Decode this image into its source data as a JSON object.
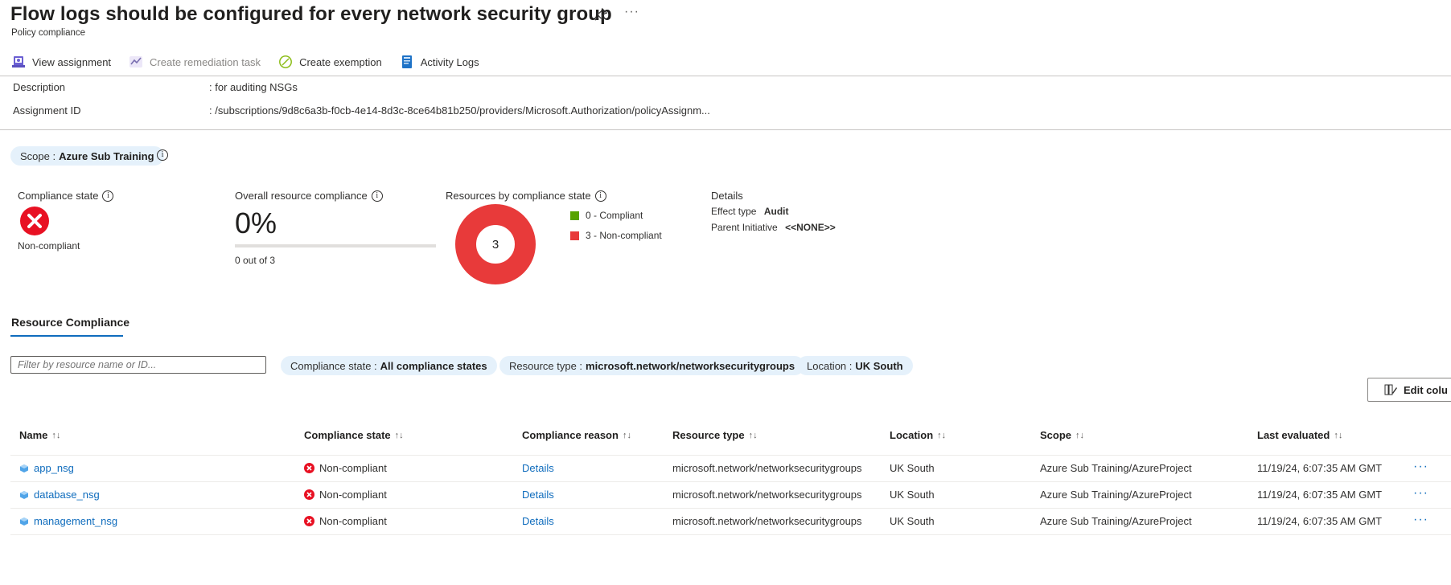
{
  "header": {
    "title": "Flow logs should be configured for every network security group",
    "subtitle": "Policy compliance"
  },
  "toolbar": {
    "view_assignment": "View assignment",
    "create_remediation": "Create remediation task",
    "create_exemption": "Create exemption",
    "activity_logs": "Activity Logs"
  },
  "info": {
    "description_label": "Description",
    "description_value": ": for auditing NSGs",
    "assignment_label": "Assignment ID",
    "assignment_value": ": /subscriptions/9d8c6a3b-f0cb-4e14-8d3c-8ce64b81b250/providers/Microsoft.Authorization/policyAssignm..."
  },
  "scope": {
    "label": "Scope :",
    "value": "Azure Sub Training"
  },
  "summary": {
    "compliance_state_label": "Compliance state",
    "compliance_state_value": "Non-compliant",
    "overall_label": "Overall resource compliance",
    "overall_percent": "0%",
    "overall_fraction": 0,
    "overall_sub": "0 out of 3",
    "resources_label": "Resources by compliance state",
    "donut_total": "3",
    "legend_compliant": "0 - Compliant",
    "legend_noncompliant": "3 - Non-compliant",
    "compliant_color": "#57a300",
    "noncompliant_color": "#e83a3a",
    "details_label": "Details",
    "effect_type_label": "Effect type",
    "effect_type_value": "Audit",
    "parent_label": "Parent Initiative",
    "parent_value": "<<NONE>>"
  },
  "tabs": {
    "resource_compliance": "Resource Compliance"
  },
  "filters": {
    "search_placeholder": "Filter by resource name or ID...",
    "compliance_label": "Compliance state :",
    "compliance_value": "All compliance states",
    "type_label": "Resource type :",
    "type_value": "microsoft.network/networksecuritygroups",
    "location_label": "Location :",
    "location_value": "UK South",
    "edit_columns": "Edit colu"
  },
  "table": {
    "headers": {
      "name": "Name",
      "state": "Compliance state",
      "reason": "Compliance reason",
      "type": "Resource type",
      "location": "Location",
      "scope": "Scope",
      "evaluated": "Last evaluated"
    },
    "rows": [
      {
        "name": "app_nsg",
        "state": "Non-compliant",
        "reason": "Details",
        "type": "microsoft.network/networksecuritygroups",
        "location": "UK South",
        "scope": "Azure Sub Training/AzureProject",
        "evaluated": "11/19/24, 6:07:35 AM GMT"
      },
      {
        "name": "database_nsg",
        "state": "Non-compliant",
        "reason": "Details",
        "type": "microsoft.network/networksecuritygroups",
        "location": "UK South",
        "scope": "Azure Sub Training/AzureProject",
        "evaluated": "11/19/24, 6:07:35 AM GMT"
      },
      {
        "name": "management_nsg",
        "state": "Non-compliant",
        "reason": "Details",
        "type": "microsoft.network/networksecuritygroups",
        "location": "UK South",
        "scope": "Azure Sub Training/AzureProject",
        "evaluated": "11/19/24, 6:07:35 AM GMT"
      }
    ]
  }
}
